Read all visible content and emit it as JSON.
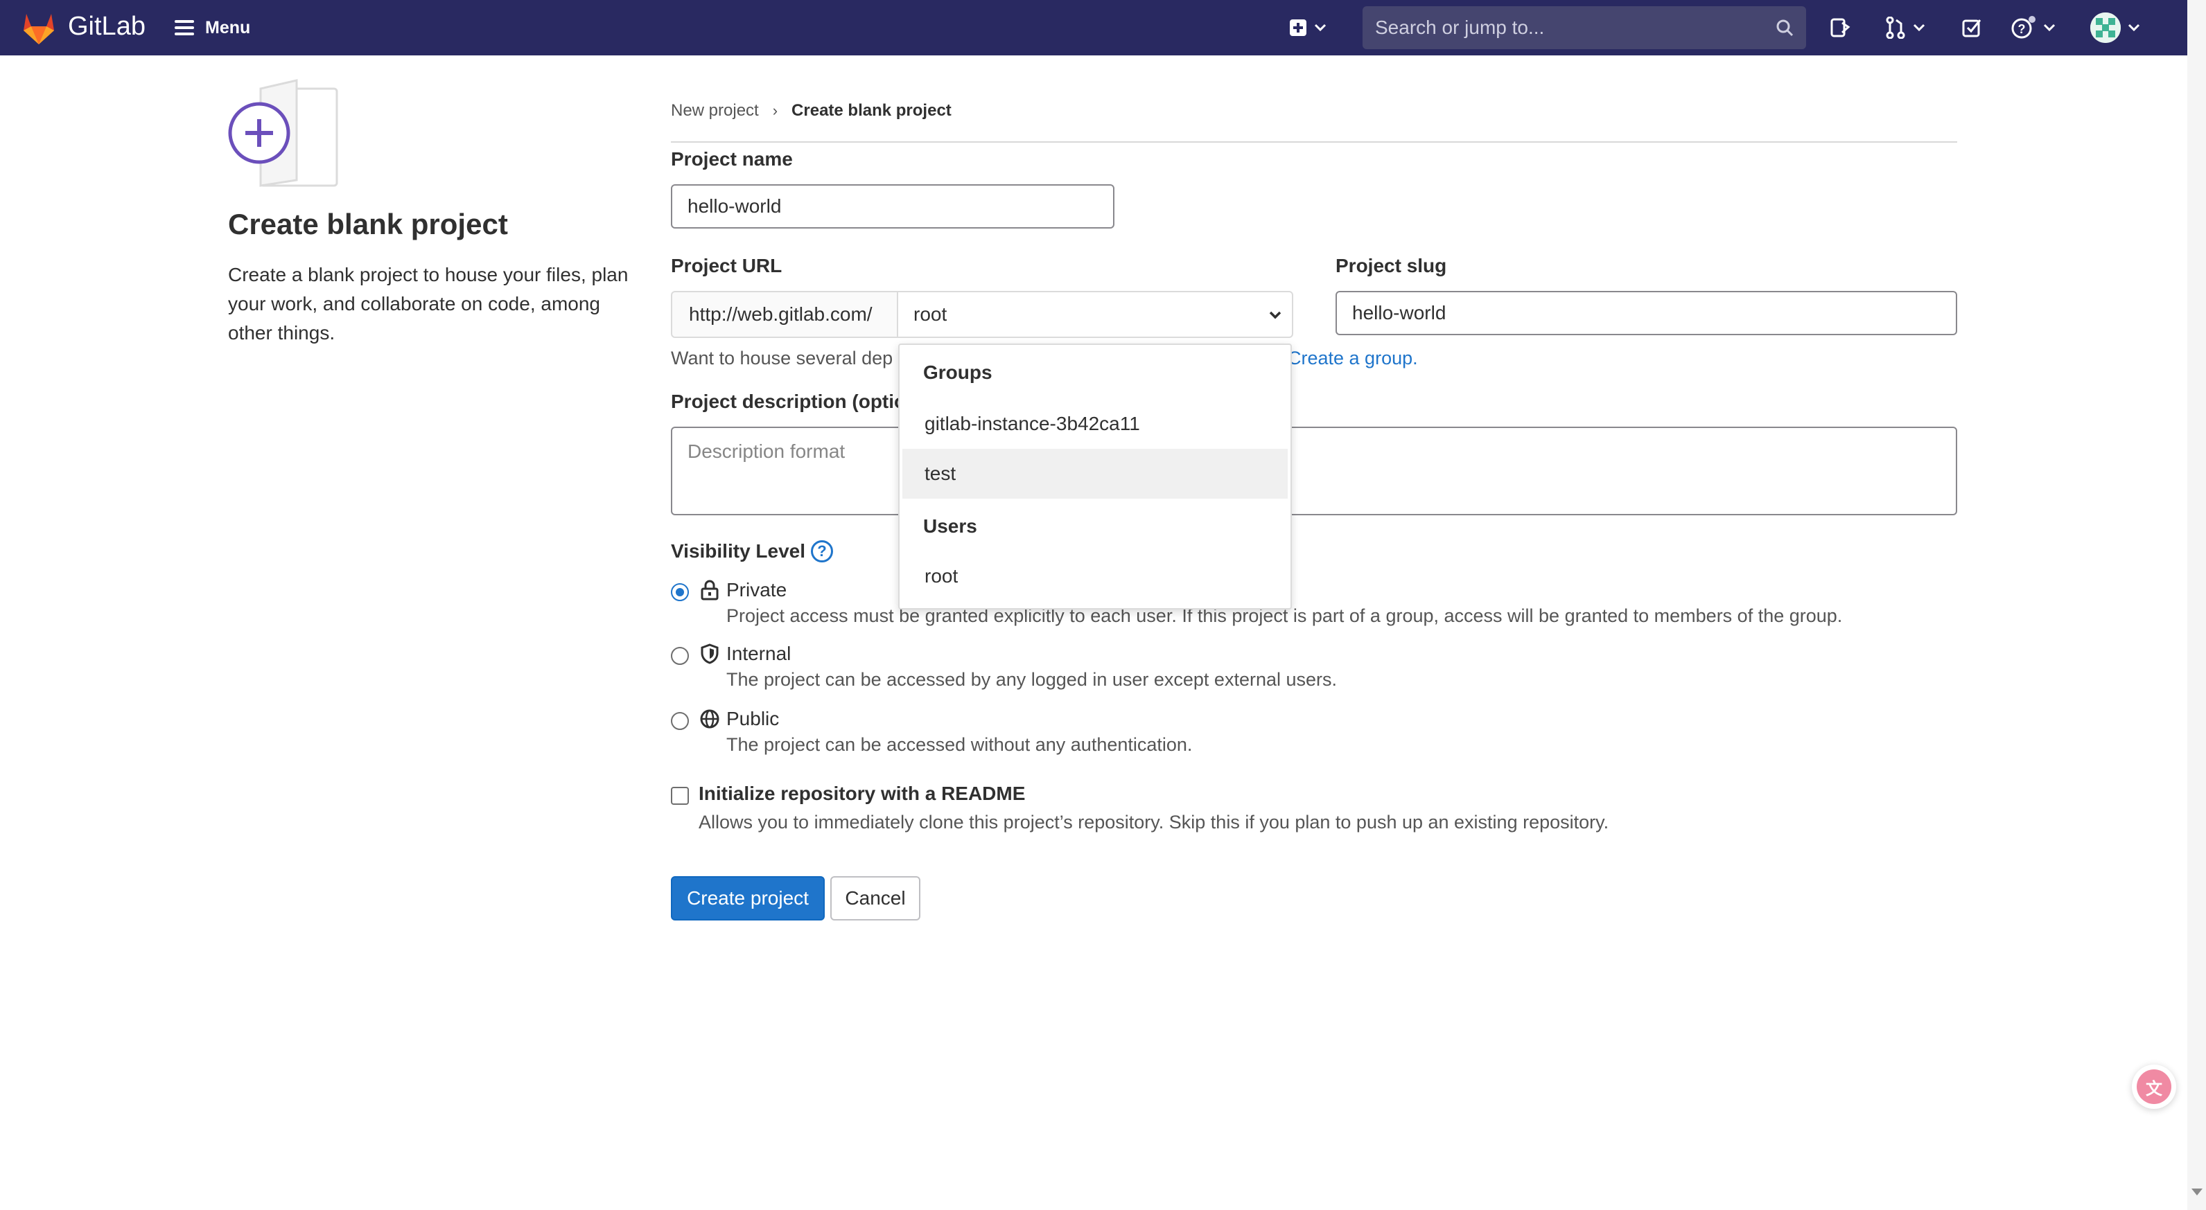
{
  "navbar": {
    "brand": "GitLab",
    "menu_label": "Menu",
    "search_placeholder": "Search or jump to...",
    "icons": [
      "gitlab-logo-icon",
      "hamburger-icon",
      "plus-square-icon",
      "chevron-down-icon",
      "search-icon",
      "issues-icon",
      "merge-request-icon",
      "todo-icon",
      "help-icon",
      "avatar"
    ]
  },
  "sidebar": {
    "title": "Create blank project",
    "description": "Create a blank project to house your files, plan your work, and collaborate on code, among other things."
  },
  "breadcrumb": {
    "parent": "New project",
    "current": "Create blank project"
  },
  "form": {
    "project_name_label": "Project name",
    "project_name_value": "hello-world",
    "project_url_label": "Project URL",
    "url_prefix": "http://web.gitlab.com/",
    "namespace_value": "root",
    "project_slug_label": "Project slug",
    "project_slug_value": "hello-world",
    "help_text": "Want to house several dep",
    "help_link": "Create a group.",
    "description_label": "Project description (optio",
    "description_placeholder": "Description format",
    "visibility_label": "Visibility Level",
    "visibility_options": [
      {
        "title": "Private",
        "description": "Project access must be granted explicitly to each user. If this project is part of a group, access will be granted to members of the group.",
        "checked": true,
        "icon": "lock-icon"
      },
      {
        "title": "Internal",
        "description": "The project can be accessed by any logged in user except external users.",
        "checked": false,
        "icon": "shield-icon"
      },
      {
        "title": "Public",
        "description": "The project can be accessed without any authentication.",
        "checked": false,
        "icon": "globe-icon"
      }
    ],
    "readme_label": "Initialize repository with a README",
    "readme_description": "Allows you to immediately clone this project’s repository. Skip this if you plan to push up an existing repository.",
    "readme_checked": false,
    "create_button": "Create project",
    "cancel_button": "Cancel"
  },
  "namespace_dropdown": {
    "groups_header": "Groups",
    "groups": [
      "gitlab-instance-3b42ca11",
      "test"
    ],
    "users_header": "Users",
    "users": [
      "root"
    ],
    "highlighted": "test"
  },
  "colors": {
    "navbar_bg": "#292961",
    "primary": "#1f75cb",
    "illustration_accent": "#6b4fbb"
  }
}
